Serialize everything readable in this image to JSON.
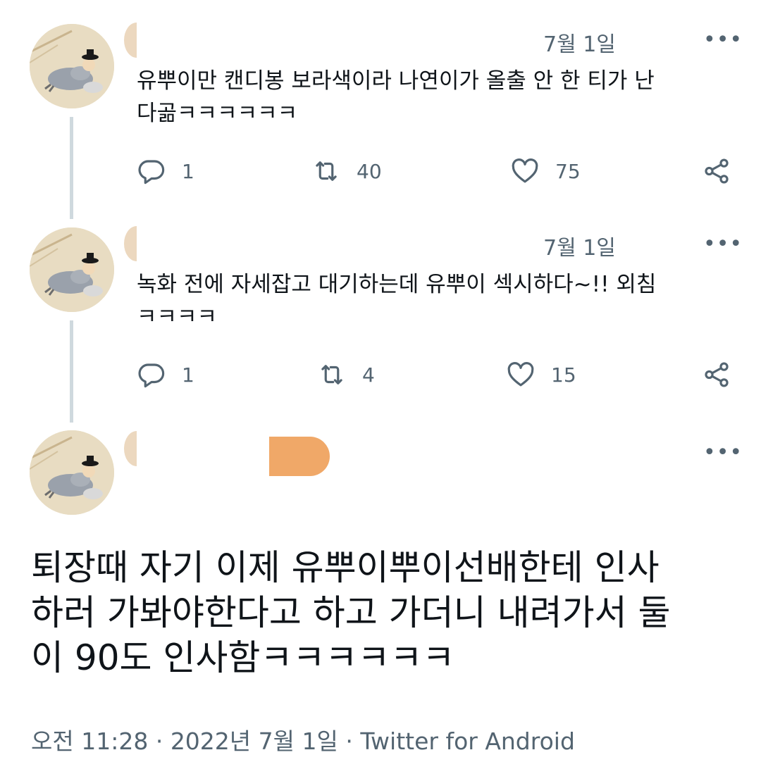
{
  "colors": {
    "text": "#0f1419",
    "secondary": "#536471",
    "thread_line": "#cfd9de",
    "name_redaction": "#f0a868"
  },
  "tweets": [
    {
      "date": "7월 1일",
      "more_icon": "more-horizontal-icon",
      "text": "유뿌이만 캔디봉 보라색이라 나연이가 올출 안 한 티가 난다곪ㅋㅋㅋㅋㅋㅋ",
      "line1": "유뿌이만 캔디봉 보라색이라 나연이가 올출 안 한 티가 난",
      "line2": "다곪ㅋㅋㅋㅋㅋㅋ",
      "replies": "1",
      "retweets": "40",
      "likes": "75"
    },
    {
      "date": "7월 1일",
      "more_icon": "more-horizontal-icon",
      "line1": "녹화 전에 자세잡고 대기하는데 유뿌이 섹시하다~!! 외침",
      "line2": "ㅋㅋㅋㅋ",
      "replies": "1",
      "retweets": "4",
      "likes": "15"
    }
  ],
  "main_tweet": {
    "more_icon": "more-horizontal-icon",
    "line1": "퇴장때 자기 이제 유뿌이뿌이선배한테 인사",
    "line2": "하러 가봐야한다고 하고 가더니 내려가서 둘",
    "line3": "이 90도 인사함ㅋㅋㅋㅋㅋㅋ",
    "time": "오전 11:28",
    "separator1": "·",
    "date": "2022년 7월 1일",
    "separator2": "·",
    "source": "Twitter for Android"
  }
}
